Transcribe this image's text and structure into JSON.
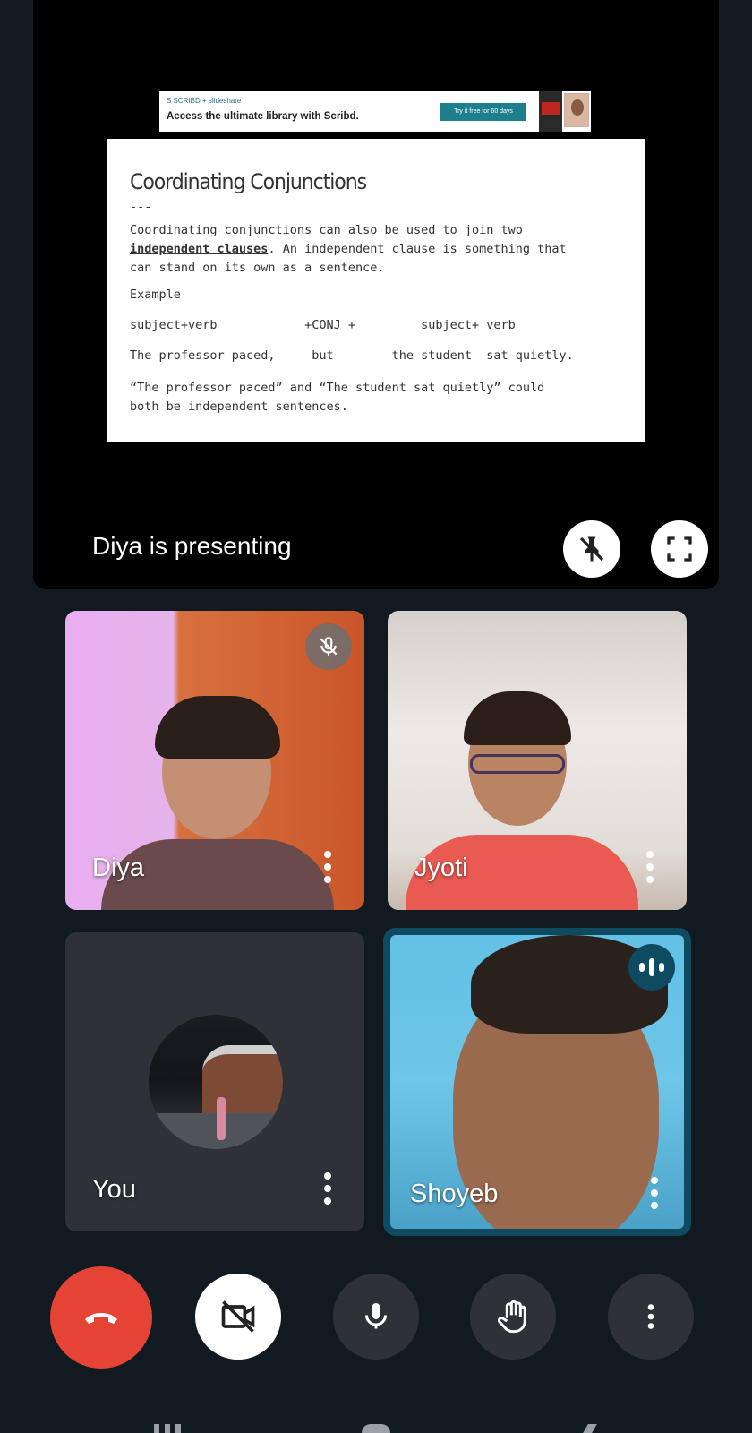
{
  "presentation": {
    "ad": {
      "brand": "S SCRIBD + slideshare",
      "tagline": "Access the ultimate library with Scribd.",
      "cta": "Try it free for 60 days"
    },
    "slide": {
      "title": "Coordinating Conjunctions",
      "divider": "---",
      "paragraph_pre": "Coordinating conjunctions can also be used to join two\n",
      "paragraph_bold": "independent clauses",
      "paragraph_post": ". An independent clause is something that\ncan stand on its own as a sentence.",
      "example_label": "Example",
      "row1": "subject+verb            +CONJ +         subject+ verb",
      "row2": "The professor paced,     but        the student  sat quietly.",
      "closing": "“The professor paced” and “The student sat quietly” could\nboth be independent sentences."
    },
    "status": "Diya is presenting"
  },
  "participants": [
    {
      "name": "Diya",
      "muted": true
    },
    {
      "name": "Jyoti",
      "muted": false
    },
    {
      "name": "You",
      "muted": false
    },
    {
      "name": "Shoyeb",
      "speaking": true
    }
  ],
  "controls": [
    "hang-up",
    "camera-off",
    "microphone",
    "raise-hand",
    "more-options"
  ],
  "colors": {
    "background": "#121a21",
    "hangup": "#e54335",
    "speaking_border": "#0e4a60",
    "control_bg": "#2e3238"
  }
}
